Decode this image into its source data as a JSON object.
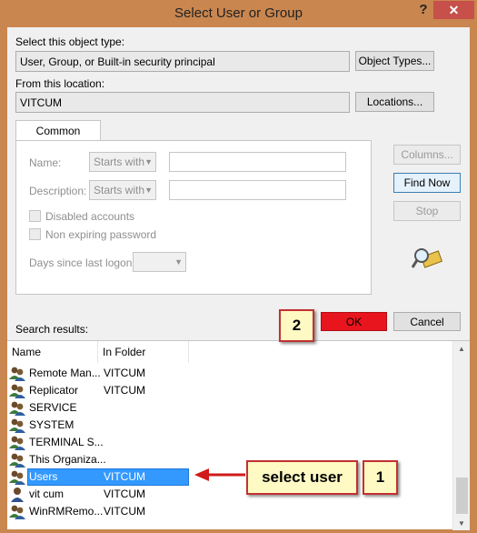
{
  "window": {
    "title": "Select User or Group",
    "help_glyph": "?",
    "close_glyph": "✕"
  },
  "object_type": {
    "label": "Select this object type:",
    "value": "User, Group, or Built-in security principal",
    "button": "Object Types..."
  },
  "location": {
    "label": "From this location:",
    "value": "VITCUM",
    "button": "Locations..."
  },
  "queries": {
    "tab": "Common Queries",
    "name_label": "Name:",
    "name_mode": "Starts with",
    "description_label": "Description:",
    "description_mode": "Starts with",
    "disabled_accounts": "Disabled accounts",
    "non_expiring_password": "Non expiring password",
    "days_since_logon": "Days since last logon:"
  },
  "side_buttons": {
    "columns": "Columns...",
    "find_now": "Find Now",
    "stop": "Stop"
  },
  "footer": {
    "search_results_label": "Search results:",
    "ok": "OK",
    "cancel": "Cancel"
  },
  "results": {
    "columns": [
      "Name",
      "In Folder"
    ],
    "rows": [
      {
        "name": "Remote Man...",
        "folder": "VITCUM"
      },
      {
        "name": "Replicator",
        "folder": "VITCUM"
      },
      {
        "name": "SERVICE",
        "folder": ""
      },
      {
        "name": "SYSTEM",
        "folder": ""
      },
      {
        "name": "TERMINAL S...",
        "folder": ""
      },
      {
        "name": "This Organiza...",
        "folder": ""
      },
      {
        "name": "Users",
        "folder": "VITCUM"
      },
      {
        "name": "vit cum",
        "folder": "VITCUM"
      },
      {
        "name": "WinRMRemo...",
        "folder": "VITCUM"
      }
    ],
    "selected_index": 6
  },
  "annotations": {
    "step_one": "1",
    "step_two": "2",
    "select_user": "select user"
  },
  "colors": {
    "title_bar": "#c9864f",
    "close": "#c7504a",
    "ok_highlight": "#e8141e",
    "selection": "#3399ff",
    "callout_fill": "#fff9c4",
    "callout_border": "#c33131"
  }
}
